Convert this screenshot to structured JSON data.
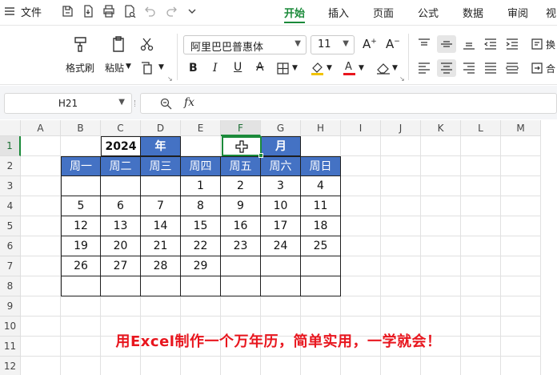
{
  "menu": {
    "file_label": "文件",
    "tabs": [
      "开始",
      "插入",
      "页面",
      "公式",
      "数据",
      "审阅",
      "视"
    ],
    "active_tab": "开始"
  },
  "ribbon": {
    "format_painter_label": "格式刷",
    "paste_label": "粘贴",
    "font_name": "阿里巴巴普惠体",
    "font_size": "11",
    "wrap_label": "换",
    "merge_label": "合"
  },
  "formula_bar": {
    "cell_ref": "H21",
    "fx_label": "fx",
    "formula": ""
  },
  "grid": {
    "columns": [
      "A",
      "B",
      "C",
      "D",
      "E",
      "F",
      "G",
      "H",
      "I",
      "J",
      "K",
      "L",
      "M"
    ],
    "rows": [
      "1",
      "2",
      "3",
      "4",
      "5",
      "6",
      "7",
      "8",
      "9",
      "10",
      "11",
      "12"
    ],
    "selected_column": "F"
  },
  "calendar": {
    "year": "2024",
    "year_label": "年",
    "month": "",
    "month_label": "月",
    "weekdays": [
      "周一",
      "周二",
      "周三",
      "周四",
      "周五",
      "周六",
      "周日"
    ],
    "weeks": [
      [
        "",
        "",
        "",
        "1",
        "2",
        "3",
        "4"
      ],
      [
        "5",
        "6",
        "7",
        "8",
        "9",
        "10",
        "11"
      ],
      [
        "12",
        "13",
        "14",
        "15",
        "16",
        "17",
        "18"
      ],
      [
        "19",
        "20",
        "21",
        "22",
        "23",
        "24",
        "25"
      ],
      [
        "26",
        "27",
        "28",
        "29",
        "",
        "",
        ""
      ],
      [
        "",
        "",
        "",
        "",
        "",
        "",
        ""
      ]
    ]
  },
  "caption": "用Excel制作一个万年历，简单实用，一学就会！"
}
